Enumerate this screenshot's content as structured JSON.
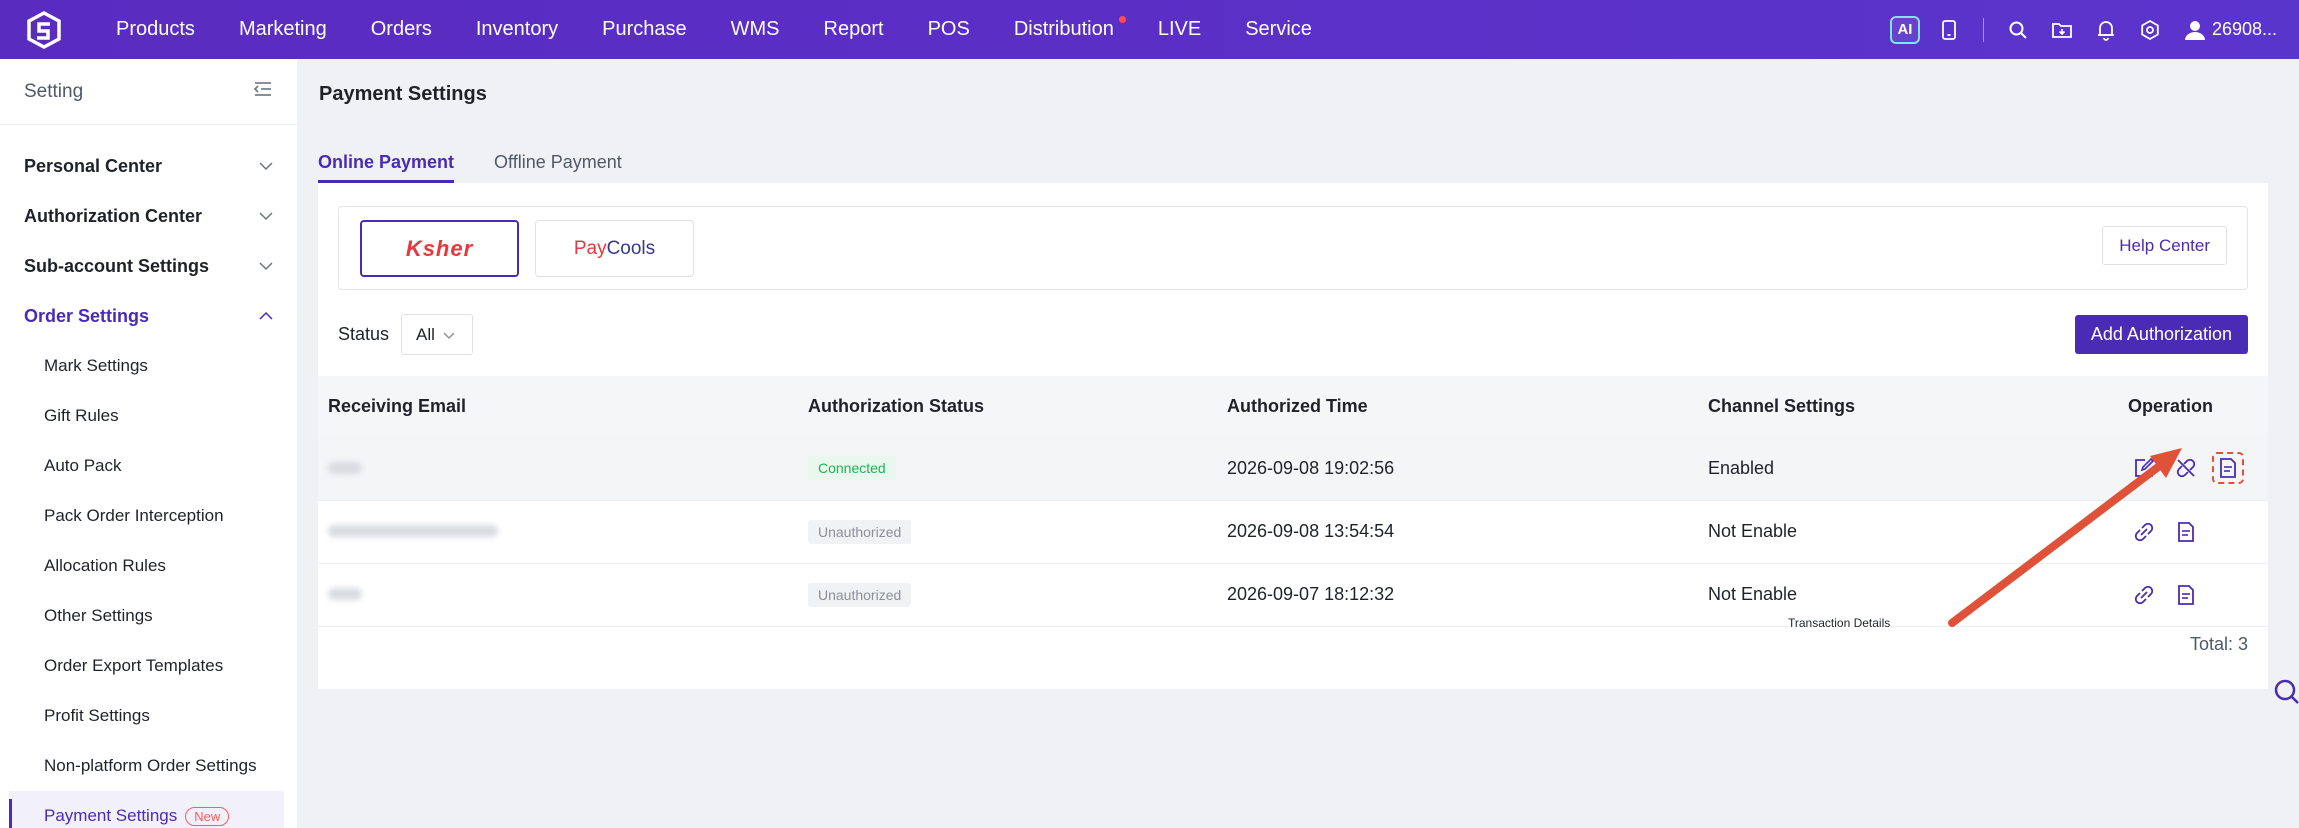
{
  "topnav": {
    "items": [
      {
        "label": "Products"
      },
      {
        "label": "Marketing"
      },
      {
        "label": "Orders"
      },
      {
        "label": "Inventory"
      },
      {
        "label": "Purchase"
      },
      {
        "label": "WMS"
      },
      {
        "label": "Report"
      },
      {
        "label": "POS"
      },
      {
        "label": "Distribution"
      },
      {
        "label": "LIVE"
      },
      {
        "label": "Service"
      }
    ],
    "ai_label": "AI",
    "user": "26908..."
  },
  "sidebar": {
    "title": "Setting",
    "groups": [
      {
        "label": "Personal Center"
      },
      {
        "label": "Authorization Center"
      },
      {
        "label": "Sub-account Settings"
      },
      {
        "label": "Order Settings"
      }
    ],
    "sub_items": [
      {
        "label": "Mark Settings"
      },
      {
        "label": "Gift Rules"
      },
      {
        "label": "Auto Pack"
      },
      {
        "label": "Pack Order Interception"
      },
      {
        "label": "Allocation Rules"
      },
      {
        "label": "Other Settings"
      },
      {
        "label": "Order Export Templates"
      },
      {
        "label": "Profit Settings"
      },
      {
        "label": "Non-platform Order Settings"
      },
      {
        "label": "Payment Settings",
        "badge": "New"
      }
    ]
  },
  "main": {
    "title": "Payment Settings",
    "tabs": [
      {
        "label": "Online Payment"
      },
      {
        "label": "Offline Payment"
      }
    ],
    "providers": {
      "ksher": "Ksher",
      "paycools_pay": "Pay",
      "paycools_cools": "Cools"
    },
    "help_button": "Help Center",
    "filter_label": "Status",
    "filter_value": "All",
    "add_button": "Add Authorization",
    "columns": [
      "Receiving Email",
      "Authorization Status",
      "Authorized Time",
      "Channel Settings",
      "Operation"
    ],
    "rows": [
      {
        "status": "Connected",
        "time": "2026-09-08 19:02:56",
        "channel": "Enabled"
      },
      {
        "status": "Unauthorized",
        "time": "2026-09-08 13:54:54",
        "channel": "Not Enable"
      },
      {
        "status": "Unauthorized",
        "time": "2026-09-07 18:12:32",
        "channel": "Not Enable"
      }
    ],
    "tooltip": "Transaction Details",
    "total": "Total: 3"
  },
  "colors": {
    "brand": "#4a2bb5",
    "nav_bg": "#5b2fc2",
    "highlight": "#e0513a",
    "success": "#20b353"
  }
}
